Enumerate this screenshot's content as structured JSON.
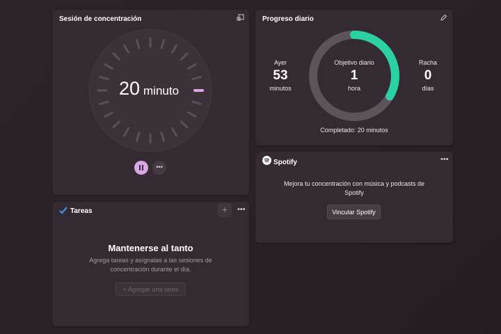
{
  "focus": {
    "title": "Sesión de concentración",
    "time_value": "20",
    "time_unit": "minuto",
    "icons": {
      "popout": "popout-icon",
      "pause": "pause-icon",
      "more": "more-icon"
    }
  },
  "tasks": {
    "title": "Tareas",
    "heading": "Mantenerse al tanto",
    "description": "Agrega tareas y asígnalas a las sesiones de concentración durante el día.",
    "add_task_label": "+ Agregar una tarea",
    "icons": {
      "app": "todo-check-icon",
      "add": "plus-icon",
      "more": "more-icon"
    }
  },
  "progress": {
    "title": "Progreso diario",
    "yesterday": {
      "label": "Ayer",
      "value": "53",
      "unit": "minutos"
    },
    "goal": {
      "label": "Objetivo diario",
      "value": "1",
      "unit": "hora"
    },
    "streak": {
      "label": "Racha",
      "value": "0",
      "unit": "días"
    },
    "completed_text": "Completado: 20 minutos",
    "completed_fraction": 0.333,
    "colors": {
      "ring_track": "#5c5459",
      "ring_fill": "#2bd1a2"
    },
    "icons": {
      "edit": "pencil-icon"
    }
  },
  "spotify": {
    "name": "Spotify",
    "description": "Mejora tu concentración con música y podcasts de Spotify",
    "link_label": "Vincular Spotify",
    "icons": {
      "logo": "spotify-icon",
      "more": "more-icon"
    }
  },
  "colors": {
    "accent_pink": "#d9a7e3",
    "accent_green": "#2bd1a2",
    "card_bg": "#332b31"
  }
}
